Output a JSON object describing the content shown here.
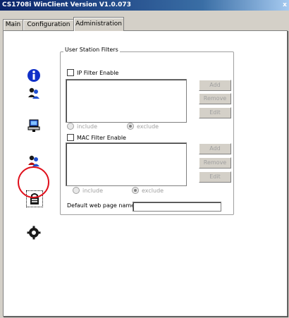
{
  "window": {
    "title": "CS1708i WinClient Version V1.0.073",
    "close_glyph": "x"
  },
  "tabs": [
    {
      "label": "Main"
    },
    {
      "label": "Configuration"
    },
    {
      "label": "Administration",
      "active": true
    }
  ],
  "sidebar": {
    "icons": [
      {
        "name": "info-icon"
      },
      {
        "name": "user-accounts-icon"
      },
      {
        "name": "computer-network-icon"
      },
      {
        "name": "user-station-icon"
      },
      {
        "name": "security-lock-icon",
        "highlighted": true,
        "highlight_color": "#e0101c"
      },
      {
        "name": "settings-gear-icon"
      }
    ]
  },
  "filters": {
    "group_label": "User Station Filters",
    "ip": {
      "enable_label": "IP Filter Enable",
      "buttons": [
        "Add",
        "Remove",
        "Edit"
      ],
      "include_label": "include",
      "exclude_label": "exclude"
    },
    "mac": {
      "enable_label": "MAC Filter Enable",
      "buttons": [
        "Add",
        "Remove",
        "Edit"
      ],
      "include_label": "include",
      "exclude_label": "exclude"
    }
  },
  "default_page": {
    "label": "Default web page name",
    "value": ""
  }
}
